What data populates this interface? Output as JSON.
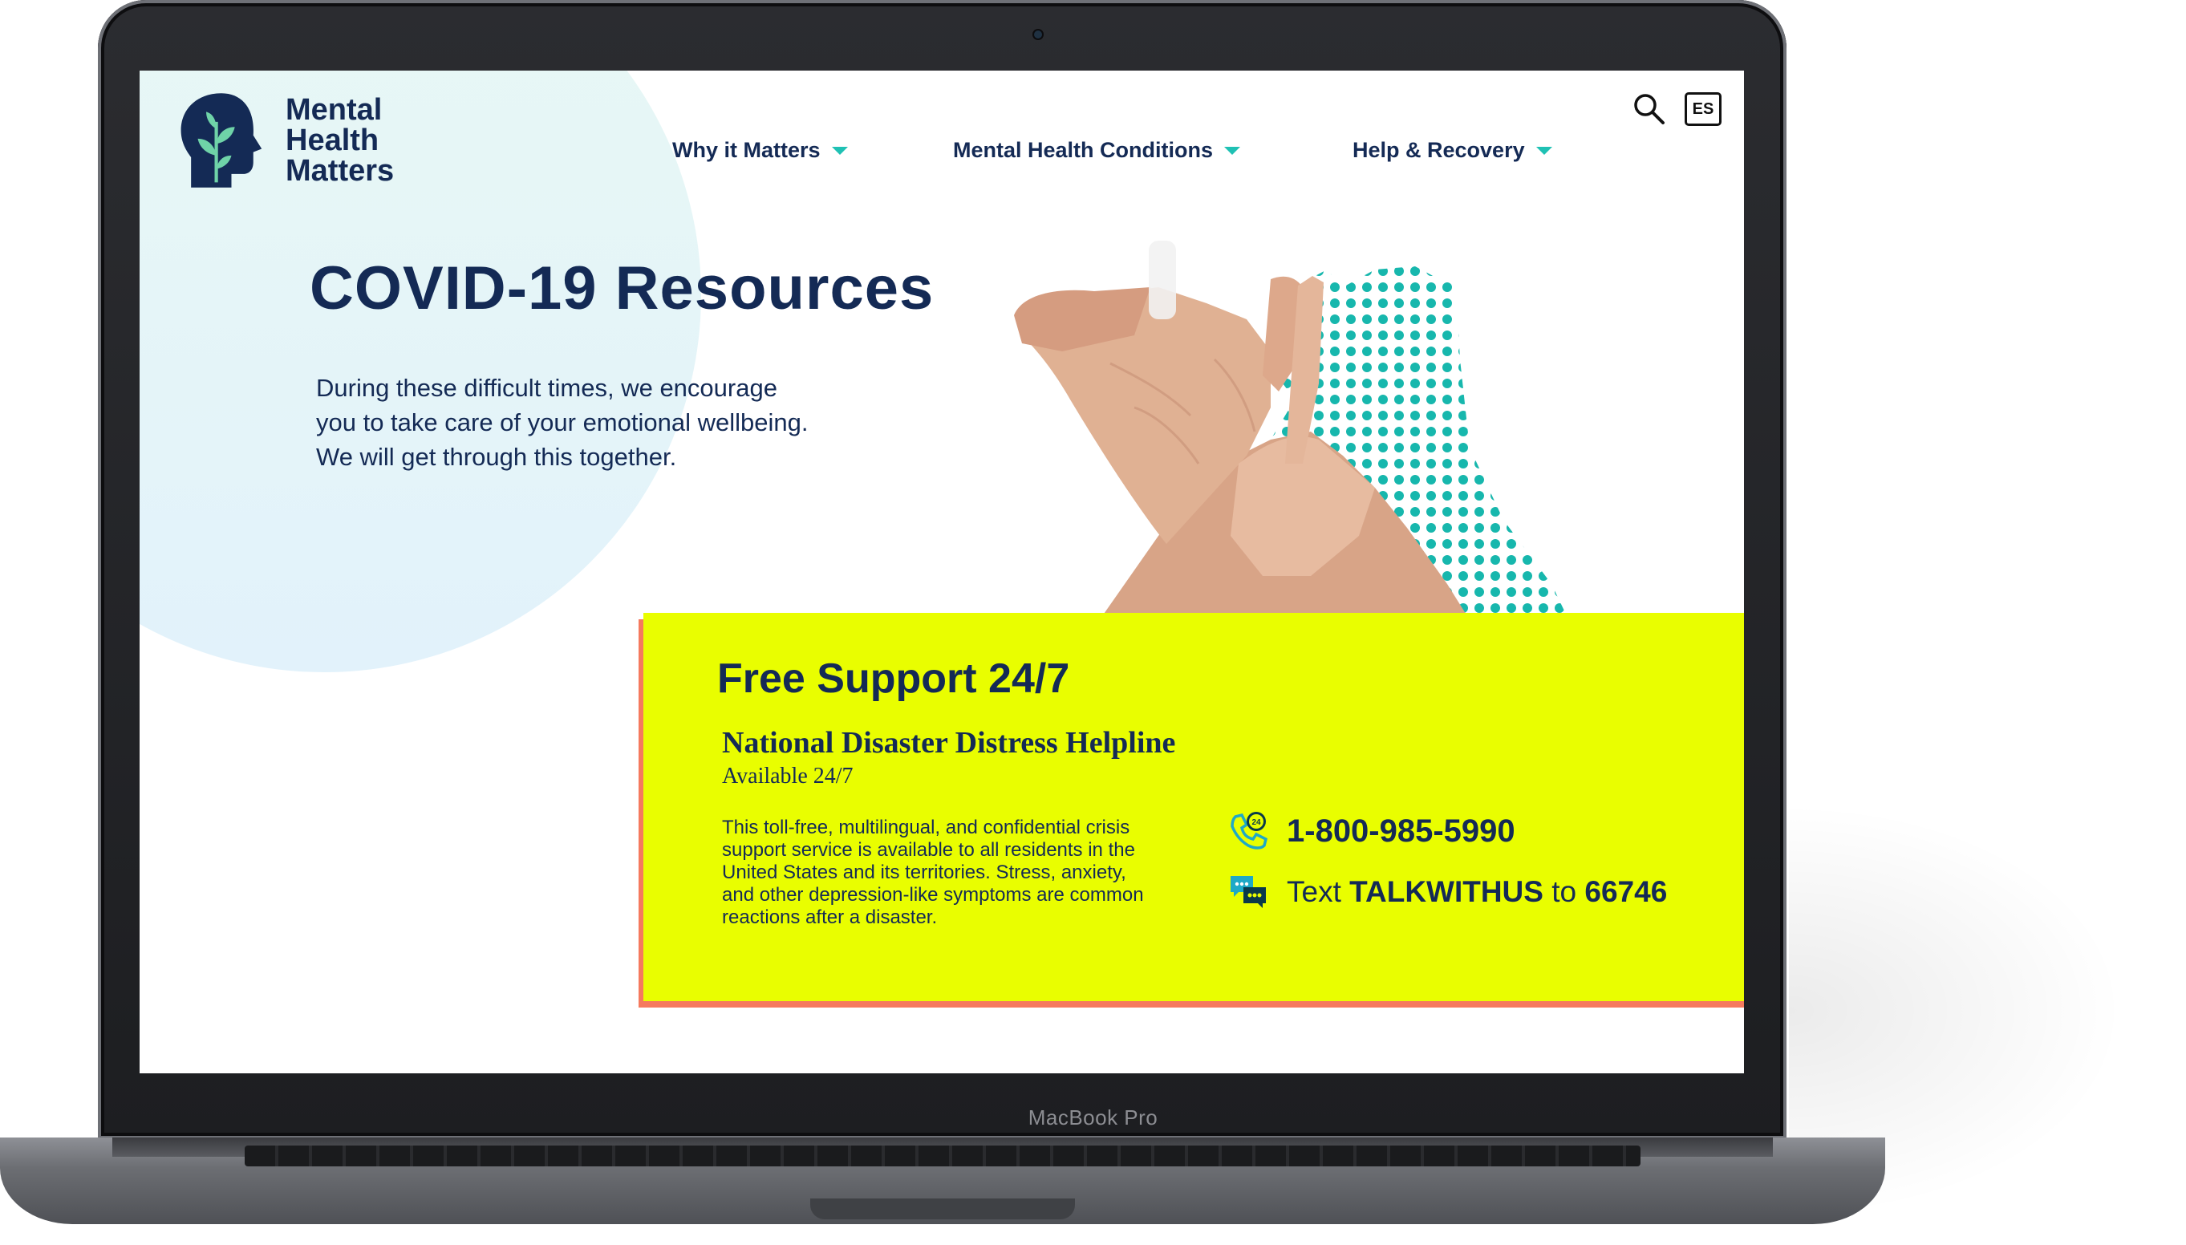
{
  "device": {
    "label": "MacBook Pro"
  },
  "site": {
    "logo": {
      "line1": "Mental",
      "line2": "Health",
      "line3": "Matters"
    },
    "nav": [
      {
        "label": "Why it Matters"
      },
      {
        "label": "Mental Health Conditions"
      },
      {
        "label": "Help & Recovery"
      }
    ],
    "language_button": "ES",
    "icons": {
      "search": "search-icon",
      "logo": "head-with-leaves-icon",
      "phone": "phone-24-icon",
      "chat": "chat-bubbles-icon",
      "dropdown": "caret-down-icon"
    }
  },
  "hero": {
    "title": "COVID-19 Resources",
    "text": "During these difficult times, we encourage you to take care of your emotional wellbeing. We will get through this together."
  },
  "support": {
    "title": "Free Support 24/7",
    "helpline_name": "National Disaster Distress Helpline",
    "availability": "Available 24/7",
    "description": "This toll-free, multilingual, and confidential crisis support service is available to all residents in the United States and its territories. Stress, anxiety, and other depression-like symptoms are common reactions after a disaster.",
    "phone": "1-800-985-5990",
    "text_prefix": "Text",
    "text_keyword": "TALKWITHUS",
    "text_mid": "to",
    "text_number": "66746"
  },
  "colors": {
    "navy": "#142a55",
    "teal": "#1fc1b4",
    "card_yellow": "#e9fe00",
    "card_shadow": "#f57a5e",
    "blob": "#e6f6f7"
  }
}
